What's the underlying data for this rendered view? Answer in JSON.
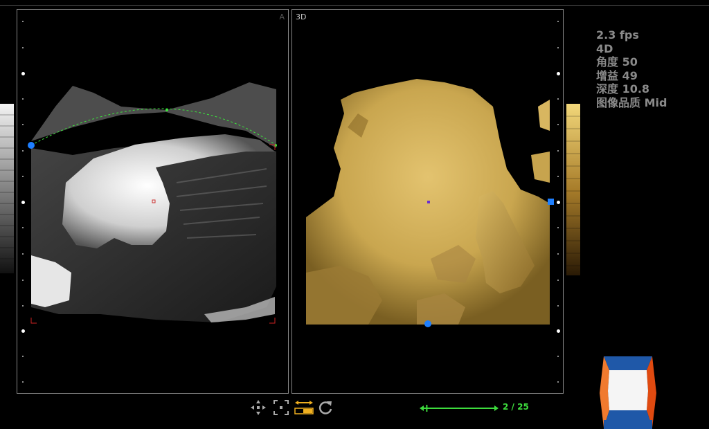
{
  "panels": {
    "left": {
      "label": "A"
    },
    "right": {
      "label": "3D"
    }
  },
  "info": {
    "fps": "2.3 fps",
    "mode": "4D",
    "angle": "角度 50",
    "gain": "增益 49",
    "depth": "深度 10.8",
    "quality": "图像品质 Mid"
  },
  "progress": {
    "label": "2 / 25",
    "current": 2,
    "total": 25
  },
  "icons": {
    "move": "move-icon",
    "fit": "fit-zoom-icon",
    "swap": "swap-arrows-icon",
    "rotate": "rotate-icon"
  },
  "colors": {
    "render_gold": "#c9a64f",
    "curve_green": "#3ce63c",
    "marker_blue": "#1e7fff",
    "orient_orange": "#f07a2e",
    "orient_blue": "#1f58a8"
  }
}
